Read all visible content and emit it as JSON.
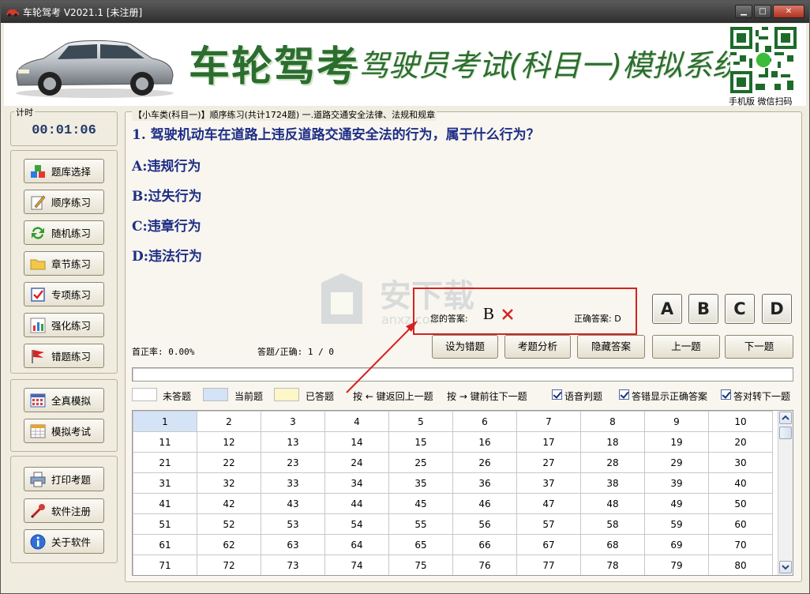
{
  "window": {
    "title": "车轮驾考 V2021.1 [未注册]",
    "controls": [
      "minimize",
      "maximize",
      "close"
    ]
  },
  "banner": {
    "brand": "车轮驾考",
    "subtitle": "--驾驶员考试(科目一)模拟系统",
    "qr_label": "手机版 微信扫码"
  },
  "timer": {
    "label": "计时",
    "value": "00:01:06"
  },
  "sidebar": {
    "group1": [
      {
        "label": "题库选择",
        "icon": "cubes-icon"
      },
      {
        "label": "顺序练习",
        "icon": "pencil-note-icon"
      },
      {
        "label": "随机练习",
        "icon": "refresh-arrows-icon"
      },
      {
        "label": "章节练习",
        "icon": "folder-icon"
      },
      {
        "label": "专项练习",
        "icon": "checklist-icon"
      },
      {
        "label": "强化练习",
        "icon": "bar-chart-icon"
      },
      {
        "label": "错题练习",
        "icon": "red-flag-icon"
      }
    ],
    "group2": [
      {
        "label": "全真模拟",
        "icon": "grid-calc-icon"
      },
      {
        "label": "模拟考试",
        "icon": "calendar-grid-icon"
      }
    ],
    "group3": [
      {
        "label": "打印考题",
        "icon": "printer-icon"
      },
      {
        "label": "软件注册",
        "icon": "key-pen-icon"
      },
      {
        "label": "关于软件",
        "icon": "info-icon"
      }
    ]
  },
  "breadcrumb": "【小车类(科目一)】顺序练习(共计1724题) 一.道路交通安全法律、法规和规章",
  "question": {
    "text": "1. 驾驶机动车在道路上违反道路交通安全法的行为，属于什么行为？",
    "options": [
      "A:违规行为",
      "B:过失行为",
      "C:违章行为",
      "D:违法行为"
    ]
  },
  "answer": {
    "your_label": "您的答案:",
    "your_value": "B",
    "correct_label": "正确答案: D",
    "result": "wrong"
  },
  "choices": [
    "A",
    "B",
    "C",
    "D"
  ],
  "stats": {
    "first_rate": "首正率: 0.00%",
    "answered": "答题/正确: 1 / 0"
  },
  "actions": [
    "设为错题",
    "考题分析",
    "隐藏答案",
    "上一题",
    "下一题"
  ],
  "legend": {
    "unanswered": "未答题",
    "current": "当前题",
    "answered": "已答题",
    "hint_prev": "按 ← 键返回上一题",
    "hint_next": "按 → 键前往下一题",
    "colors": {
      "unanswered": "#ffffff",
      "current": "#d4e3f5",
      "answered": "#fdf6c8"
    }
  },
  "options": [
    {
      "label": "语音判题",
      "checked": true
    },
    {
      "label": "答错显示正确答案",
      "checked": true
    },
    {
      "label": "答对转下一题",
      "checked": true
    }
  ],
  "grid": {
    "current": 1,
    "rows": [
      [
        "1",
        "2",
        "3",
        "4",
        "5",
        "6",
        "7",
        "8",
        "9",
        "10"
      ],
      [
        "11",
        "12",
        "13",
        "14",
        "15",
        "16",
        "17",
        "18",
        "19",
        "20"
      ],
      [
        "21",
        "22",
        "23",
        "24",
        "25",
        "26",
        "27",
        "28",
        "29",
        "30"
      ],
      [
        "31",
        "32",
        "33",
        "34",
        "35",
        "36",
        "37",
        "38",
        "39",
        "40"
      ],
      [
        "41",
        "42",
        "43",
        "44",
        "45",
        "46",
        "47",
        "48",
        "49",
        "50"
      ],
      [
        "51",
        "52",
        "53",
        "54",
        "55",
        "56",
        "57",
        "58",
        "59",
        "60"
      ],
      [
        "61",
        "62",
        "63",
        "64",
        "65",
        "66",
        "67",
        "68",
        "69",
        "70"
      ],
      [
        "71",
        "72",
        "73",
        "74",
        "75",
        "76",
        "77",
        "78",
        "79",
        "80"
      ]
    ]
  },
  "watermark": {
    "text": "安下载",
    "sub": "anxz.com"
  },
  "colors": {
    "question_text": "#1e2e86",
    "brand_green": "#2b6d2f",
    "highlight_red": "#d42222",
    "current_cell": "#d4e3f5"
  }
}
